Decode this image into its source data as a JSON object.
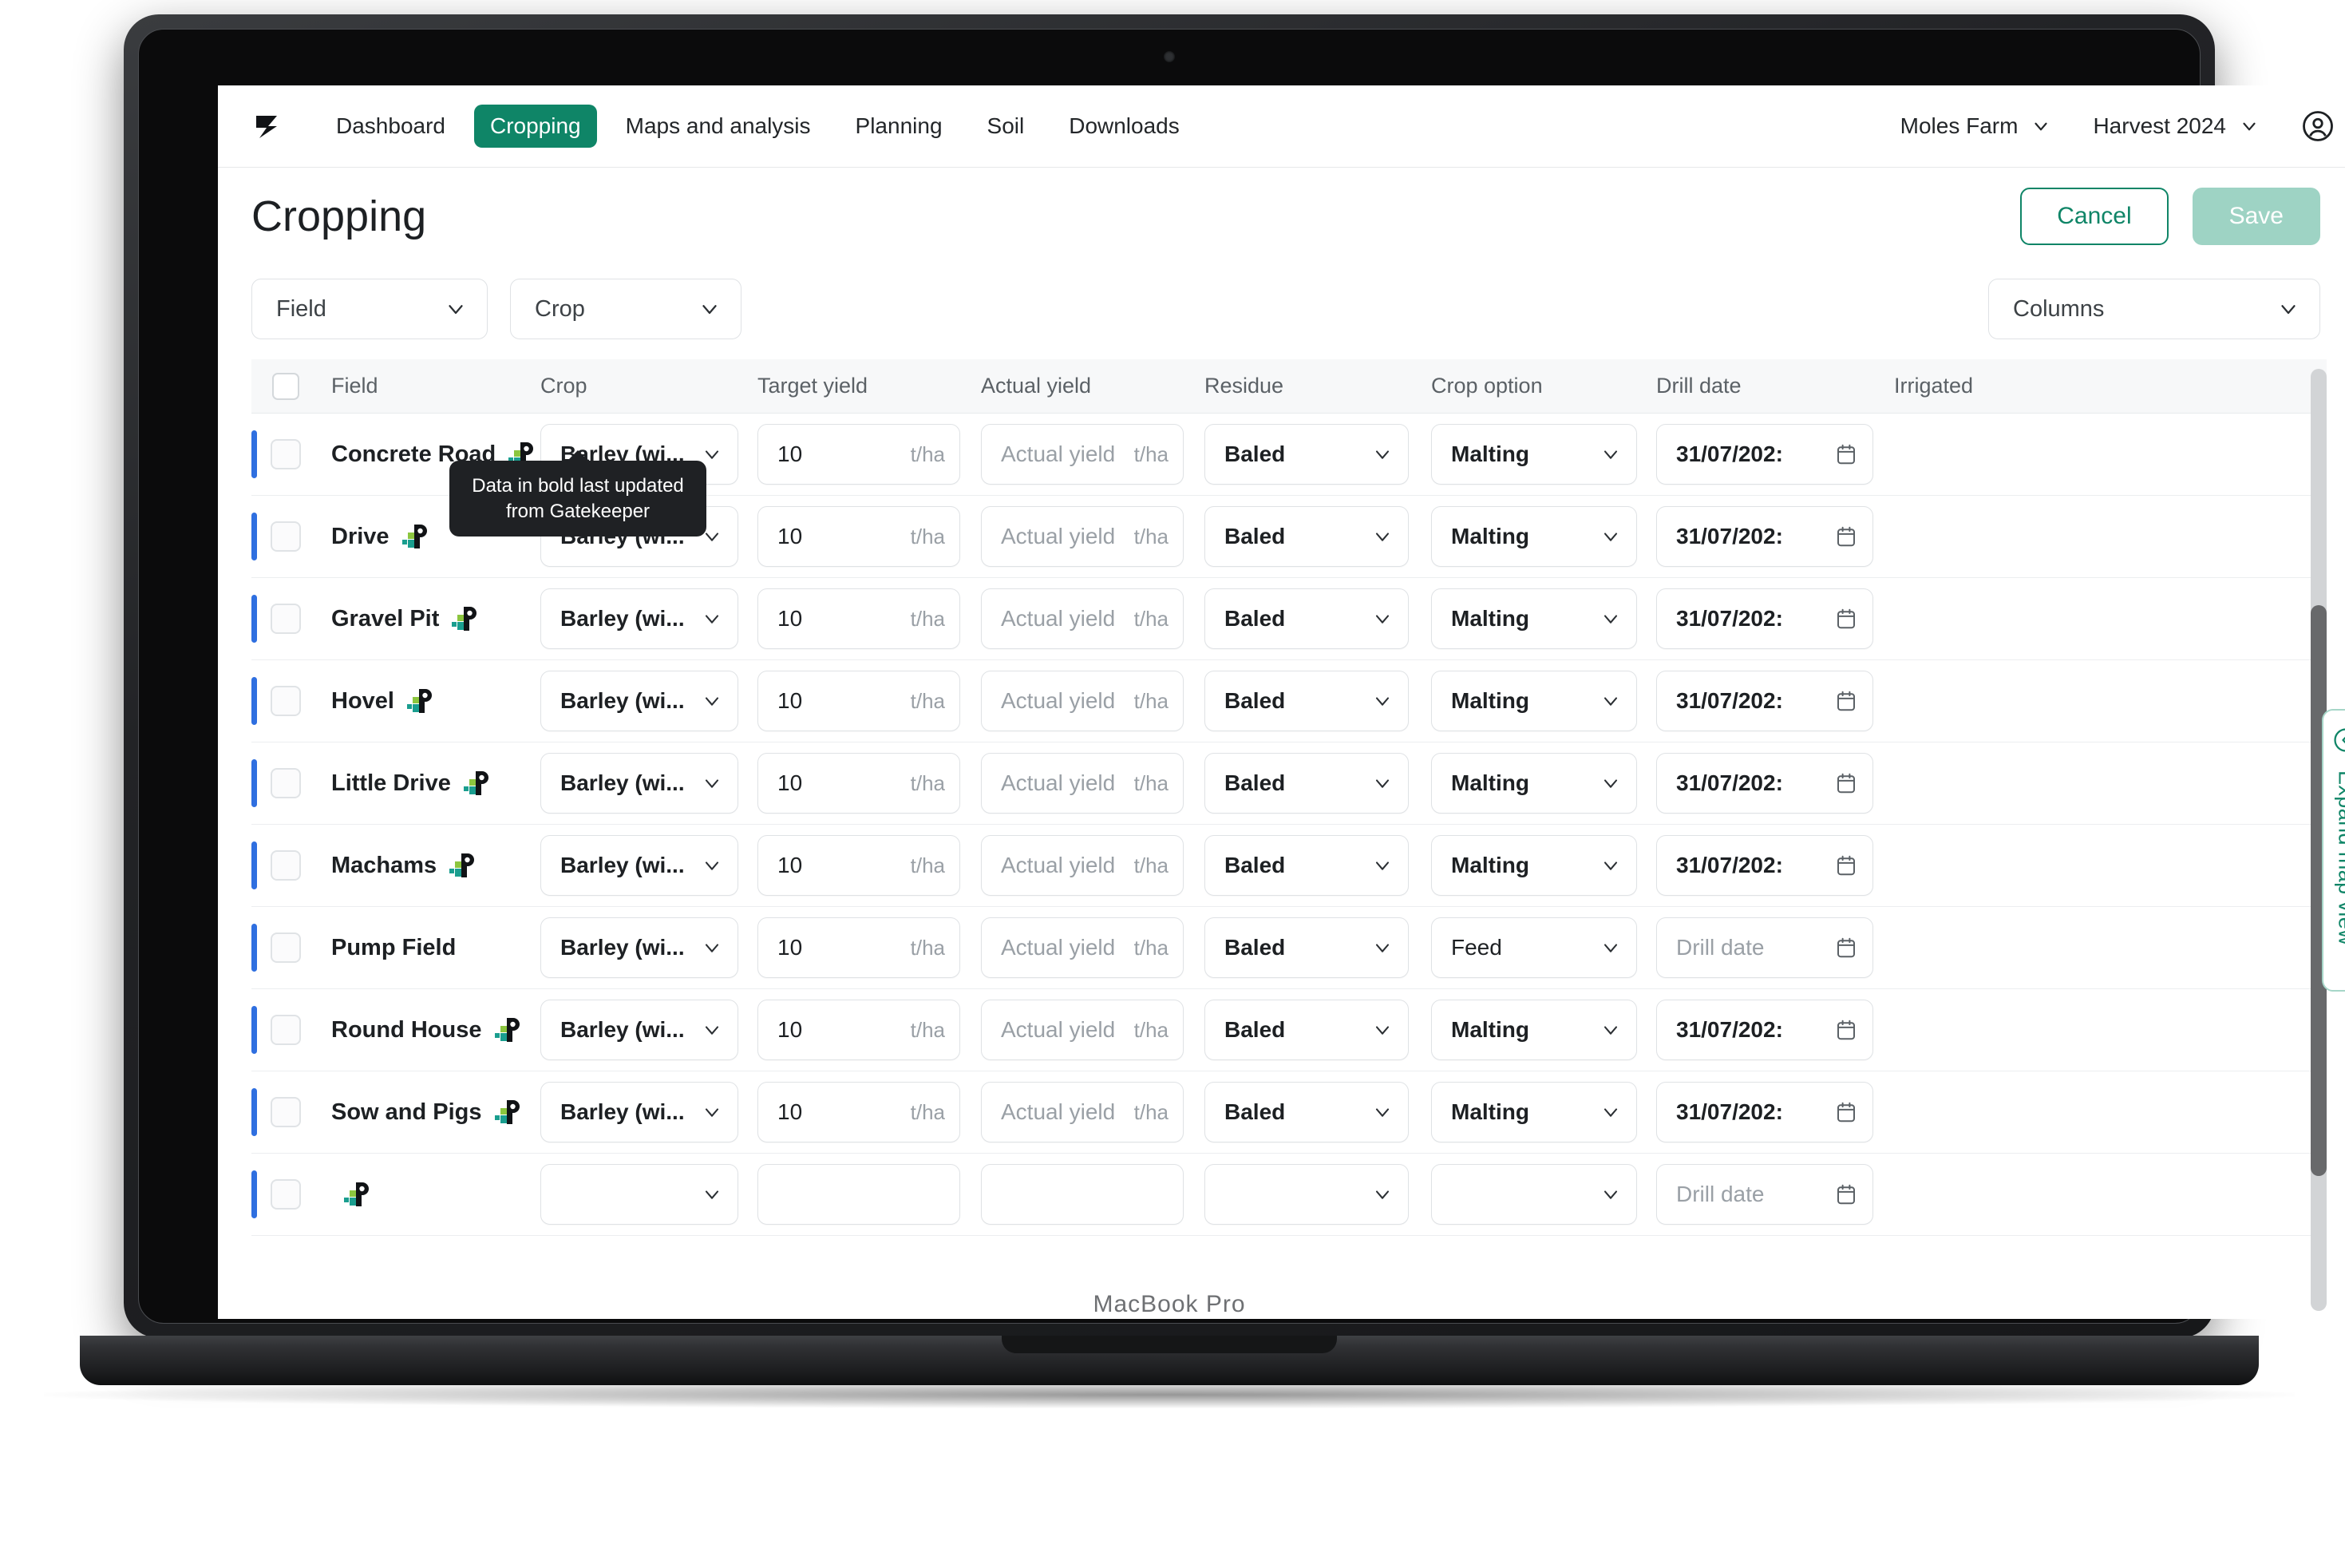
{
  "device": {
    "label": "MacBook Pro"
  },
  "navbar": {
    "logo": "z-logo-icon",
    "links": [
      {
        "label": "Dashboard",
        "active": false
      },
      {
        "label": "Cropping",
        "active": true
      },
      {
        "label": "Maps and analysis",
        "active": false
      },
      {
        "label": "Planning",
        "active": false
      },
      {
        "label": "Soil",
        "active": false
      },
      {
        "label": "Downloads",
        "active": false
      }
    ],
    "farm_selector": "Moles Farm",
    "season_selector": "Harvest 2024",
    "avatar": "user-avatar-icon"
  },
  "header": {
    "title": "Cropping",
    "cancel_label": "Cancel",
    "save_label": "Save"
  },
  "filters": {
    "field_label": "Field",
    "crop_label": "Crop",
    "columns_label": "Columns"
  },
  "table": {
    "columns": [
      "Field",
      "Crop",
      "Target yield",
      "Actual yield",
      "Residue",
      "Crop option",
      "Drill date",
      "Irrigated"
    ],
    "units": {
      "yield": "t/ha"
    },
    "placeholders": {
      "actual_yield": "Actual yield",
      "drill_date": "Drill date"
    },
    "rows": [
      {
        "field": "Concrete Road",
        "gatekeeper": true,
        "crop": "Barley (wi...",
        "target_yield": "10",
        "actual_yield": "",
        "residue": "Baled",
        "crop_option": "Malting",
        "crop_option_bold": true,
        "drill_date": "31/07/202:",
        "irrigated": ""
      },
      {
        "field": "Drive",
        "gatekeeper": true,
        "crop": "Barley (wi...",
        "target_yield": "10",
        "actual_yield": "",
        "residue": "Baled",
        "crop_option": "Malting",
        "crop_option_bold": true,
        "drill_date": "31/07/202:",
        "irrigated": ""
      },
      {
        "field": "Gravel Pit",
        "gatekeeper": true,
        "crop": "Barley (wi...",
        "target_yield": "10",
        "actual_yield": "",
        "residue": "Baled",
        "crop_option": "Malting",
        "crop_option_bold": true,
        "drill_date": "31/07/202:",
        "irrigated": ""
      },
      {
        "field": "Hovel",
        "gatekeeper": true,
        "crop": "Barley (wi...",
        "target_yield": "10",
        "actual_yield": "",
        "residue": "Baled",
        "crop_option": "Malting",
        "crop_option_bold": true,
        "drill_date": "31/07/202:",
        "irrigated": ""
      },
      {
        "field": "Little Drive",
        "gatekeeper": true,
        "crop": "Barley (wi...",
        "target_yield": "10",
        "actual_yield": "",
        "residue": "Baled",
        "crop_option": "Malting",
        "crop_option_bold": true,
        "drill_date": "31/07/202:",
        "irrigated": ""
      },
      {
        "field": "Machams",
        "gatekeeper": true,
        "crop": "Barley (wi...",
        "target_yield": "10",
        "actual_yield": "",
        "residue": "Baled",
        "crop_option": "Malting",
        "crop_option_bold": true,
        "drill_date": "31/07/202:",
        "irrigated": ""
      },
      {
        "field": "Pump Field",
        "gatekeeper": false,
        "crop": "Barley (wi...",
        "target_yield": "10",
        "actual_yield": "",
        "residue": "Baled",
        "crop_option": "Feed",
        "crop_option_bold": false,
        "drill_date": "",
        "irrigated": ""
      },
      {
        "field": "Round House",
        "gatekeeper": true,
        "crop": "Barley (wi...",
        "target_yield": "10",
        "actual_yield": "",
        "residue": "Baled",
        "crop_option": "Malting",
        "crop_option_bold": true,
        "drill_date": "31/07/202:",
        "irrigated": ""
      },
      {
        "field": "Sow and Pigs",
        "gatekeeper": true,
        "crop": "Barley (wi...",
        "target_yield": "10",
        "actual_yield": "",
        "residue": "Baled",
        "crop_option": "Malting",
        "crop_option_bold": true,
        "drill_date": "31/07/202:",
        "irrigated": ""
      },
      {
        "field": "",
        "gatekeeper": true,
        "crop": "",
        "target_yield": "",
        "actual_yield": "",
        "residue": "",
        "crop_option": "",
        "crop_option_bold": false,
        "drill_date": "",
        "irrigated": ""
      }
    ]
  },
  "tooltip": {
    "text": "Data in bold last updated from Gatekeeper"
  },
  "map_panel": {
    "expand_label": "Expand map view",
    "collapse_icon": "chevron-left-circle-icon"
  },
  "colors": {
    "brand_green": "#0f8567",
    "save_disabled": "#9ed3c4",
    "row_marker_blue": "#2f6fe0",
    "tooltip_bg": "#1f2124",
    "gatekeeper_green": "#8cc63f",
    "gatekeeper_teal": "#1a9e8f"
  }
}
